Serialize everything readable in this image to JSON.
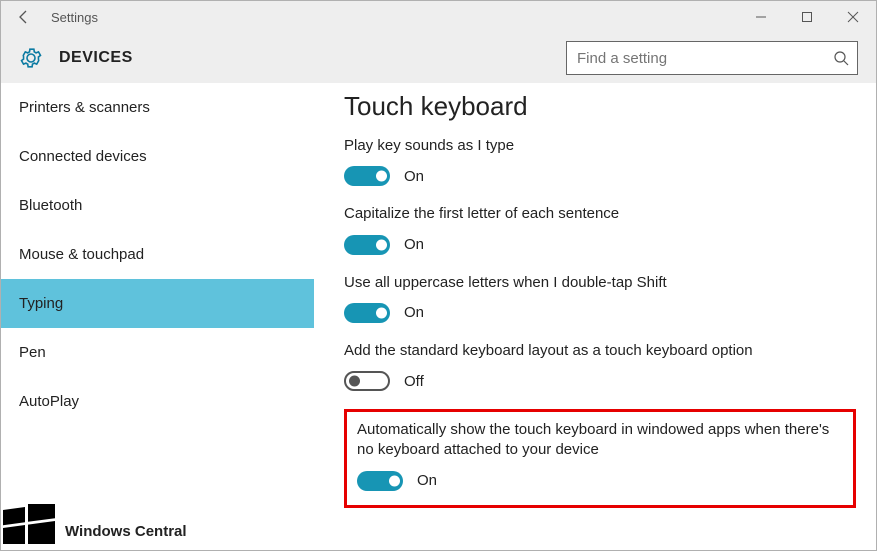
{
  "titlebar": {
    "title": "Settings"
  },
  "header": {
    "section": "DEVICES"
  },
  "search": {
    "placeholder": "Find a setting"
  },
  "sidebar": {
    "items": [
      {
        "label": "Printers & scanners",
        "selected": false
      },
      {
        "label": "Connected devices",
        "selected": false
      },
      {
        "label": "Bluetooth",
        "selected": false
      },
      {
        "label": "Mouse & touchpad",
        "selected": false
      },
      {
        "label": "Typing",
        "selected": true
      },
      {
        "label": "Pen",
        "selected": false
      },
      {
        "label": "AutoPlay",
        "selected": false
      }
    ]
  },
  "content": {
    "title": "Touch keyboard",
    "settings": [
      {
        "label": "Play key sounds as I type",
        "on": true,
        "state": "On"
      },
      {
        "label": "Capitalize the first letter of each sentence",
        "on": true,
        "state": "On"
      },
      {
        "label": "Use all uppercase letters when I double-tap Shift",
        "on": true,
        "state": "On"
      },
      {
        "label": "Add the standard keyboard layout as a touch keyboard option",
        "on": false,
        "state": "Off"
      },
      {
        "label": "Automatically show the touch keyboard in windowed apps when there's no keyboard attached to your device",
        "on": true,
        "state": "On",
        "highlighted": true
      }
    ]
  },
  "watermark": {
    "text": "Windows Central"
  }
}
